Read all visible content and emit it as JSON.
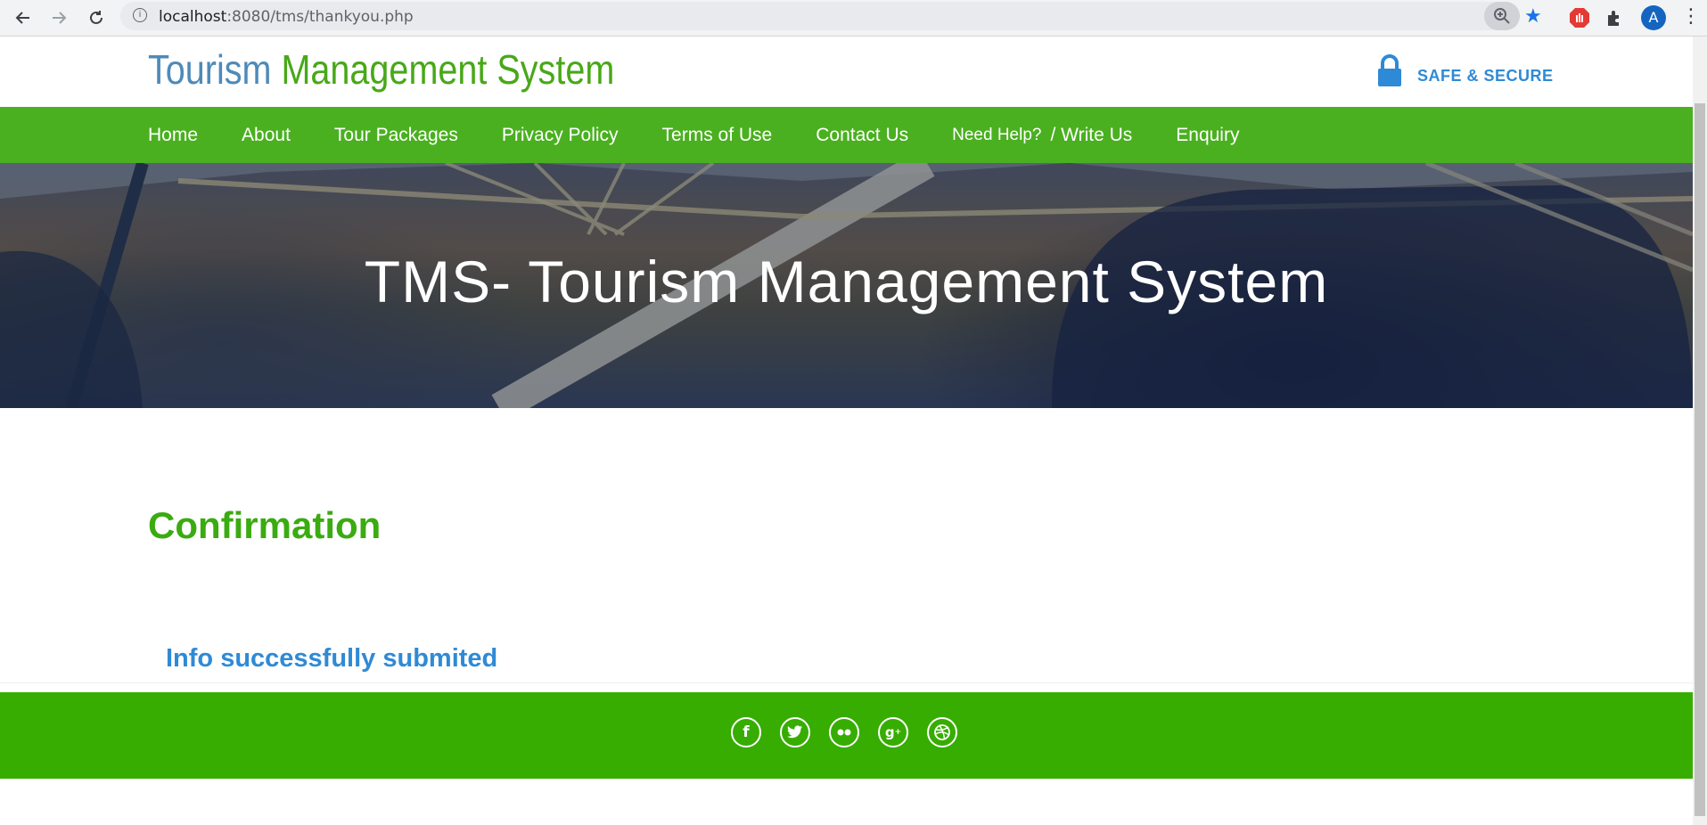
{
  "browser": {
    "url_host": "localhost",
    "url_path": ":8080/tms/thankyou.php",
    "avatar_letter": "A",
    "icons": [
      "back-arrow-icon",
      "forward-arrow-icon",
      "reload-icon",
      "info-icon",
      "zoom-icon",
      "star-icon",
      "adblock-icon",
      "extensions-icon",
      "menu-icon"
    ]
  },
  "header": {
    "logo_part1": "Tourism",
    "logo_part2": " Management System",
    "secure_label": "SAFE & SECURE",
    "logo_color1": "#4e8ab8",
    "logo_color2": "#48a818",
    "secure_color": "#2e8ad6"
  },
  "nav": {
    "bg_color": "#4ab020",
    "items": [
      "Home",
      "About",
      "Tour Packages",
      "Privacy Policy",
      "Terms of Use",
      "Contact Us"
    ],
    "help_label": "Need Help?",
    "write_label": "/ Write Us",
    "enquiry_label": "Enquiry"
  },
  "banner": {
    "title": "TMS- Tourism Management System"
  },
  "main": {
    "heading": "Confirmation",
    "message": "Info successfully submited",
    "heading_color": "#3aab10",
    "message_color": "#2f8ad6"
  },
  "footer": {
    "bg_color": "#36ad00",
    "social_icons": [
      "facebook-icon",
      "twitter-icon",
      "flickr-icon",
      "google-plus-icon",
      "dribbble-icon"
    ]
  }
}
